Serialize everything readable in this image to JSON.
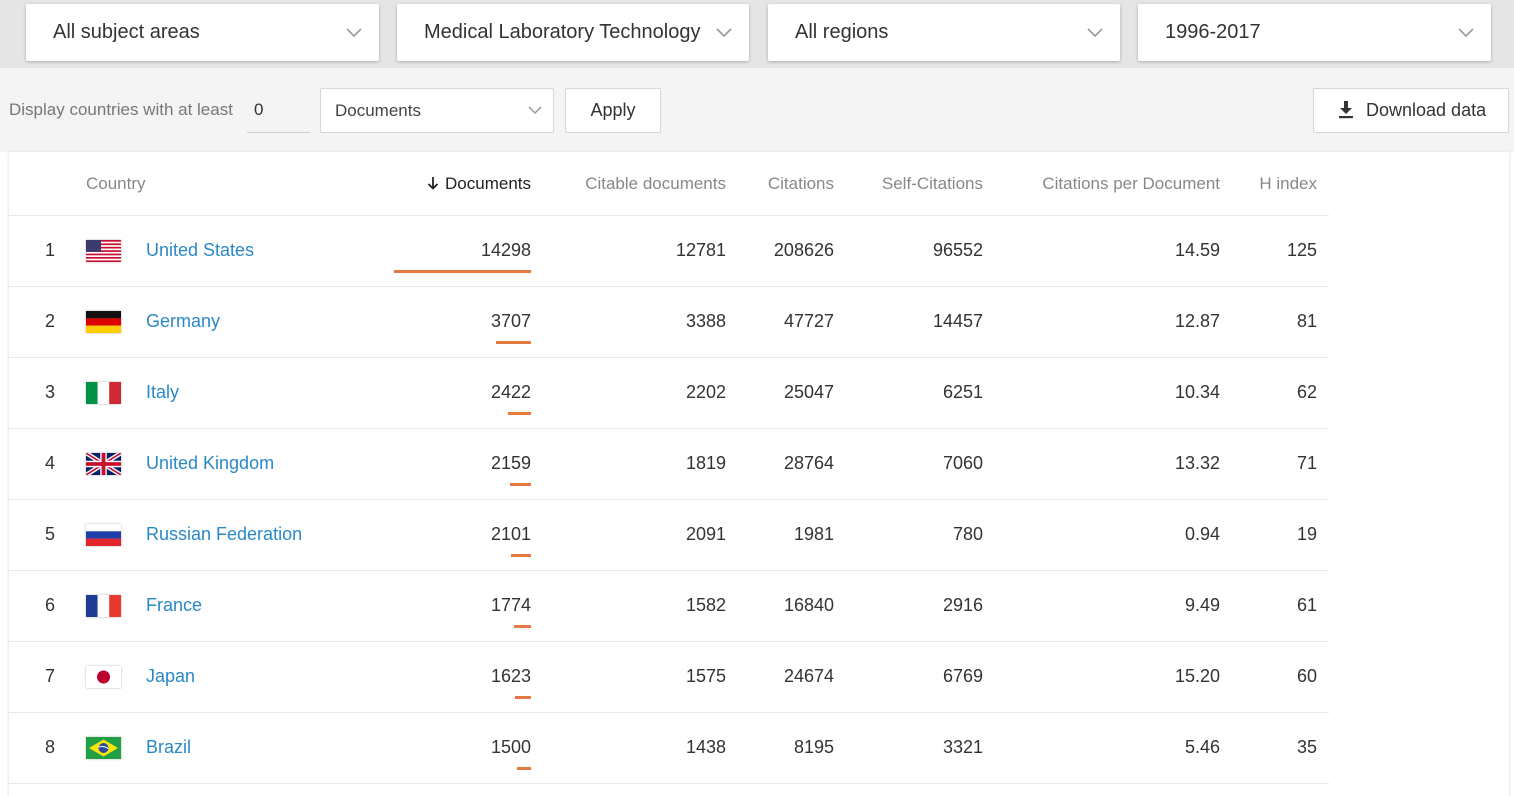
{
  "filters": {
    "subject_area": "All subject areas",
    "subject_category": "Medical Laboratory Technology",
    "region": "All regions",
    "years": "1996-2017"
  },
  "display": {
    "label": "Display countries with at least",
    "min_value": "0",
    "metric": "Documents",
    "apply_label": "Apply",
    "download_label": "Download data"
  },
  "table": {
    "headers": {
      "country": "Country",
      "documents": "Documents",
      "citable_documents": "Citable documents",
      "citations": "Citations",
      "self_citations": "Self-Citations",
      "citations_per_document": "Citations per Document",
      "h_index": "H index"
    },
    "sort_column": "documents",
    "sort_direction": "descending",
    "rows": [
      {
        "rank": "1",
        "country": "United States",
        "flag": "flag-us",
        "documents": "14298",
        "citable_documents": "12781",
        "citations": "208626",
        "self_citations": "96552",
        "citations_per_document": "14.59",
        "h_index": "125",
        "doc_bar_fraction": 1.0
      },
      {
        "rank": "2",
        "country": "Germany",
        "flag": "flag-de",
        "documents": "3707",
        "citable_documents": "3388",
        "citations": "47727",
        "self_citations": "14457",
        "citations_per_document": "12.87",
        "h_index": "81",
        "doc_bar_fraction": 0.259
      },
      {
        "rank": "3",
        "country": "Italy",
        "flag": "flag-it",
        "documents": "2422",
        "citable_documents": "2202",
        "citations": "25047",
        "self_citations": "6251",
        "citations_per_document": "10.34",
        "h_index": "62",
        "doc_bar_fraction": 0.169
      },
      {
        "rank": "4",
        "country": "United Kingdom",
        "flag": "flag-gb",
        "documents": "2159",
        "citable_documents": "1819",
        "citations": "28764",
        "self_citations": "7060",
        "citations_per_document": "13.32",
        "h_index": "71",
        "doc_bar_fraction": 0.151
      },
      {
        "rank": "5",
        "country": "Russian Federation",
        "flag": "flag-ru",
        "documents": "2101",
        "citable_documents": "2091",
        "citations": "1981",
        "self_citations": "780",
        "citations_per_document": "0.94",
        "h_index": "19",
        "doc_bar_fraction": 0.147
      },
      {
        "rank": "6",
        "country": "France",
        "flag": "flag-fr",
        "documents": "1774",
        "citable_documents": "1582",
        "citations": "16840",
        "self_citations": "2916",
        "citations_per_document": "9.49",
        "h_index": "61",
        "doc_bar_fraction": 0.124
      },
      {
        "rank": "7",
        "country": "Japan",
        "flag": "flag-jp",
        "documents": "1623",
        "citable_documents": "1575",
        "citations": "24674",
        "self_citations": "6769",
        "citations_per_document": "15.20",
        "h_index": "60",
        "doc_bar_fraction": 0.114
      },
      {
        "rank": "8",
        "country": "Brazil",
        "flag": "flag-br",
        "documents": "1500",
        "citable_documents": "1438",
        "citations": "8195",
        "self_citations": "3321",
        "citations_per_document": "5.46",
        "h_index": "35",
        "doc_bar_fraction": 0.105
      }
    ]
  },
  "colors": {
    "link": "#2a88c5",
    "bar": "#e27a42",
    "topbar": "#e5e5e5",
    "filterbar": "#f4f4f4"
  }
}
